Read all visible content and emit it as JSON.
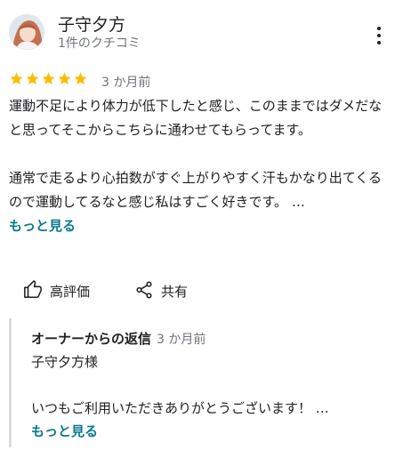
{
  "reviewer": {
    "name": "子守夕方",
    "meta": "1件のクチコミ"
  },
  "review": {
    "rating": 5,
    "rating_max": 5,
    "date": "3 か月前",
    "paragraph1": "運動不足により体力が低下したと感じ、このままではダメだなと思ってそこからこちらに通わせてもらってます。",
    "paragraph2": "通常で走るより心拍数がすぐ上がりやすく汗もかなり出てくるので運動してるなと感じ私はすごく好きです。 …",
    "more_label": "もっと見る"
  },
  "actions": {
    "like_label": "高評価",
    "share_label": "共有"
  },
  "owner_reply": {
    "owner_label": "オーナーからの返信",
    "date": "3 か月前",
    "greeting": "子守夕方様",
    "body": "いつもご利用いただきありがとうございます！ …",
    "more_label": "もっと見る"
  },
  "colors": {
    "star": "#fbbc04",
    "link": "#0b7a8c",
    "secondary_text": "#70757a"
  }
}
